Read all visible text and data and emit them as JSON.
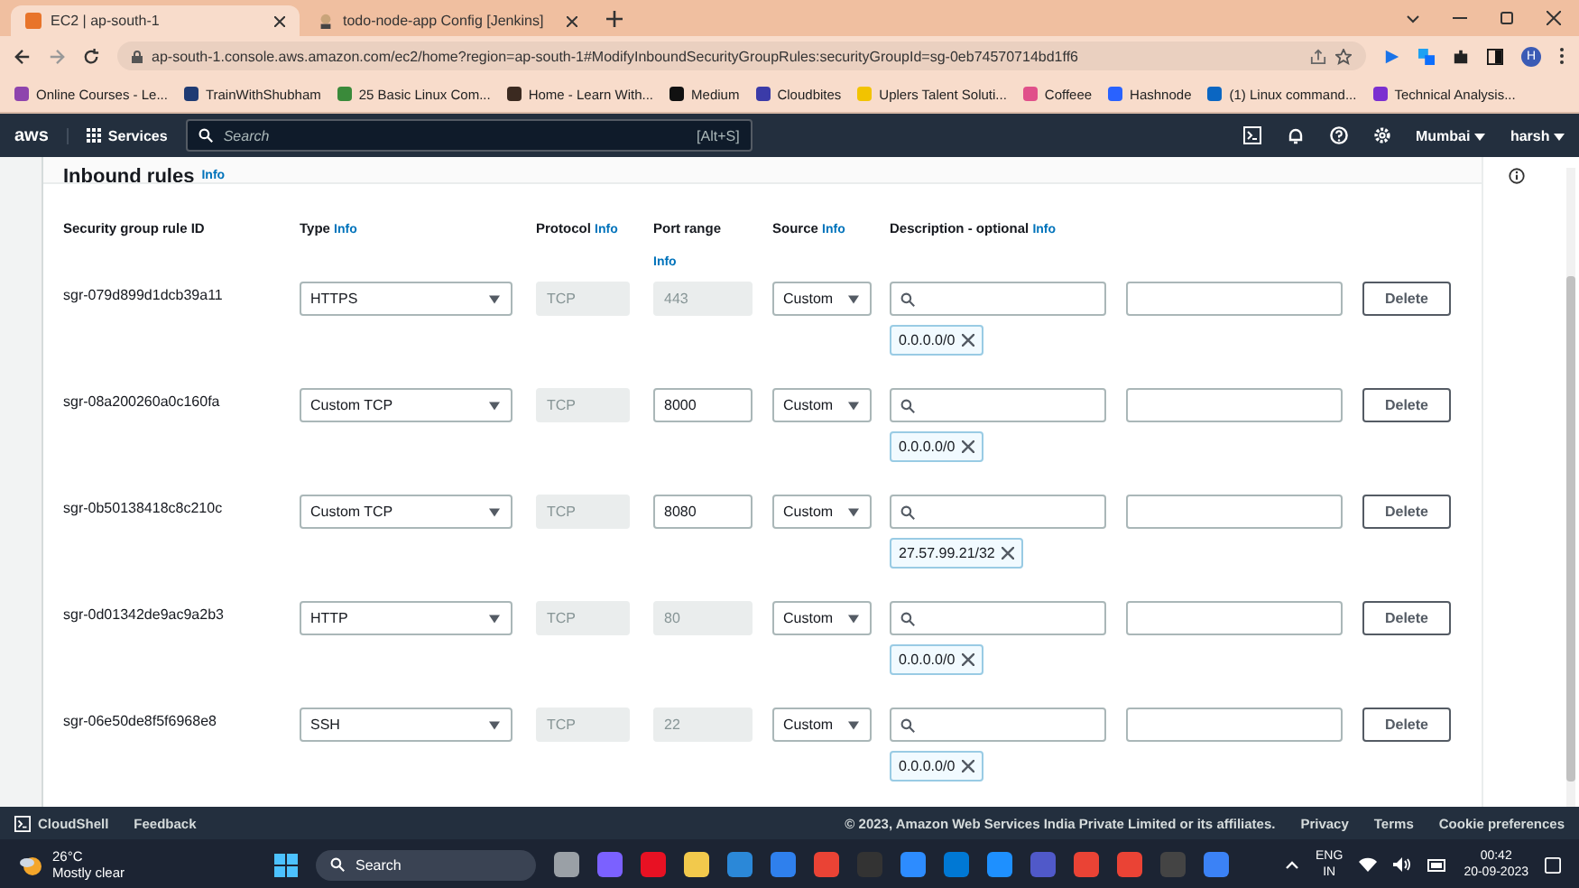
{
  "browser": {
    "tabs": [
      {
        "title": "EC2 | ap-south-1",
        "selected": true
      },
      {
        "title": "todo-node-app Config [Jenkins]",
        "selected": false
      }
    ],
    "url": "ap-south-1.console.aws.amazon.com/ec2/home?region=ap-south-1#ModifyInboundSecurityGroupRules:securityGroupId=sg-0eb74570714bd1ff6",
    "profile": "H",
    "bookmarks": [
      {
        "label": "Online Courses - Le...",
        "color": "#8e44ad"
      },
      {
        "label": "TrainWithShubham",
        "color": "#1f3b73"
      },
      {
        "label": "25 Basic Linux Com...",
        "color": "#3a8a3a"
      },
      {
        "label": "Home - Learn With...",
        "color": "#3b2a20"
      },
      {
        "label": "Medium",
        "color": "#111111"
      },
      {
        "label": "Cloudbites",
        "color": "#3b3ba8"
      },
      {
        "label": "Uplers Talent Soluti...",
        "color": "#f2c300"
      },
      {
        "label": "Coffeee",
        "color": "#e0508a"
      },
      {
        "label": "Hashnode",
        "color": "#2962ff"
      },
      {
        "label": "(1) Linux command...",
        "color": "#0a66c2"
      },
      {
        "label": "Technical Analysis...",
        "color": "#7b2fd0"
      }
    ]
  },
  "console": {
    "logo": "aws",
    "services": "Services",
    "search_placeholder": "Search",
    "search_shortcut": "[Alt+S]",
    "region": "Mumbai",
    "user": "harsh"
  },
  "section": {
    "title": "Inbound rules",
    "info": "Info"
  },
  "columns": [
    {
      "label": "Security group rule ID"
    },
    {
      "label": "Type",
      "info": "Info"
    },
    {
      "label": "Protocol",
      "info": "Info"
    },
    {
      "label": "Port range",
      "info": "Info"
    },
    {
      "label": "Source",
      "info": "Info"
    },
    {
      "label": "Description - optional",
      "info": "Info"
    }
  ],
  "rules": [
    {
      "id": "sgr-079d899d1dcb39a11",
      "type": "HTTPS",
      "protocol": "TCP",
      "port": "443",
      "port_disabled": true,
      "source": "Custom",
      "cidr": "0.0.0.0/0",
      "action": "Delete"
    },
    {
      "id": "sgr-08a200260a0c160fa",
      "type": "Custom TCP",
      "protocol": "TCP",
      "port": "8000",
      "port_disabled": false,
      "source": "Custom",
      "cidr": "0.0.0.0/0",
      "action": "Delete"
    },
    {
      "id": "sgr-0b50138418c8c210c",
      "type": "Custom TCP",
      "protocol": "TCP",
      "port": "8080",
      "port_disabled": false,
      "source": "Custom",
      "cidr": "27.57.99.21/32",
      "action": "Delete"
    },
    {
      "id": "sgr-0d01342de9ac9a2b3",
      "type": "HTTP",
      "protocol": "TCP",
      "port": "80",
      "port_disabled": true,
      "source": "Custom",
      "cidr": "0.0.0.0/0",
      "action": "Delete"
    },
    {
      "id": "sgr-06e50de8f5f6968e8",
      "type": "SSH",
      "protocol": "TCP",
      "port": "22",
      "port_disabled": true,
      "source": "Custom",
      "cidr": "0.0.0.0/0",
      "action": "Delete"
    }
  ],
  "footer": {
    "cloudshell": "CloudShell",
    "feedback": "Feedback",
    "copyright": "© 2023, Amazon Web Services India Private Limited or its affiliates.",
    "links": [
      "Privacy",
      "Terms",
      "Cookie preferences"
    ]
  },
  "taskbar": {
    "temperature": "26°C",
    "weather": "Mostly clear",
    "search": "Search",
    "language": "ENG",
    "region": "IN",
    "time": "00:42",
    "date": "20-09-2023"
  }
}
